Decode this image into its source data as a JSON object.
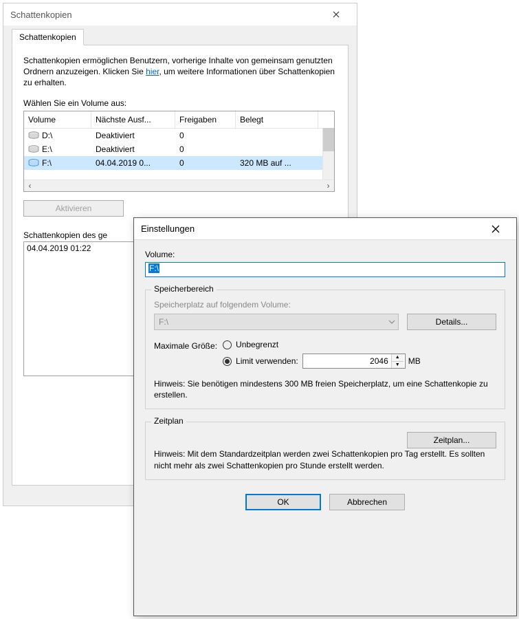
{
  "win1": {
    "title": "Schattenkopien",
    "tab_label": "Schattenkopien",
    "description_pre": "Schattenkopien ermöglichen Benutzern, vorherige Inhalte von gemeinsam genutzten Ordnern anzuzeigen. Klicken Sie ",
    "description_link": "hier",
    "description_post": ", um weitere Informationen über Schattenkopien zu erhalten.",
    "select_volume_label": "Wählen Sie ein Volume aus:",
    "table": {
      "headers": {
        "volume": "Volume",
        "next": "Nächste Ausf...",
        "shares": "Freigaben",
        "used": "Belegt"
      },
      "rows": [
        {
          "volume": "D:\\",
          "next": "Deaktiviert",
          "shares": "0",
          "used": "",
          "selected": false
        },
        {
          "volume": "E:\\",
          "next": "Deaktiviert",
          "shares": "0",
          "used": "",
          "selected": false
        },
        {
          "volume": "F:\\",
          "next": "04.04.2019 0...",
          "shares": "0",
          "used": "320 MB auf ...",
          "selected": true
        }
      ]
    },
    "buttons": {
      "activate": "Aktivieren"
    },
    "copies_label": "Schattenkopien des ge",
    "copies_list": [
      "04.04.2019 01:22"
    ]
  },
  "win2": {
    "title": "Einstellungen",
    "volume_label": "Volume:",
    "volume_value": "F:\\",
    "storage": {
      "legend": "Speicherbereich",
      "location_label": "Speicherplatz auf folgendem Volume:",
      "location_value": "F:\\",
      "details_btn": "Details...",
      "maxsize_label": "Maximale Größe:",
      "radio_unlimited": "Unbegrenzt",
      "radio_limit": "Limit verwenden:",
      "limit_value": "2046",
      "limit_unit": "MB",
      "hint": "Hinweis: Sie benötigen mindestens 300 MB freien Speicherplatz, um eine Schattenkopie zu erstellen."
    },
    "schedule": {
      "legend": "Zeitplan",
      "btn": "Zeitplan...",
      "hint": "Hinweis: Mit dem Standardzeitplan werden zwei Schattenkopien pro Tag erstellt. Es sollten nicht mehr als zwei Schattenkopien pro Stunde erstellt werden."
    },
    "buttons": {
      "ok": "OK",
      "cancel": "Abbrechen"
    }
  }
}
